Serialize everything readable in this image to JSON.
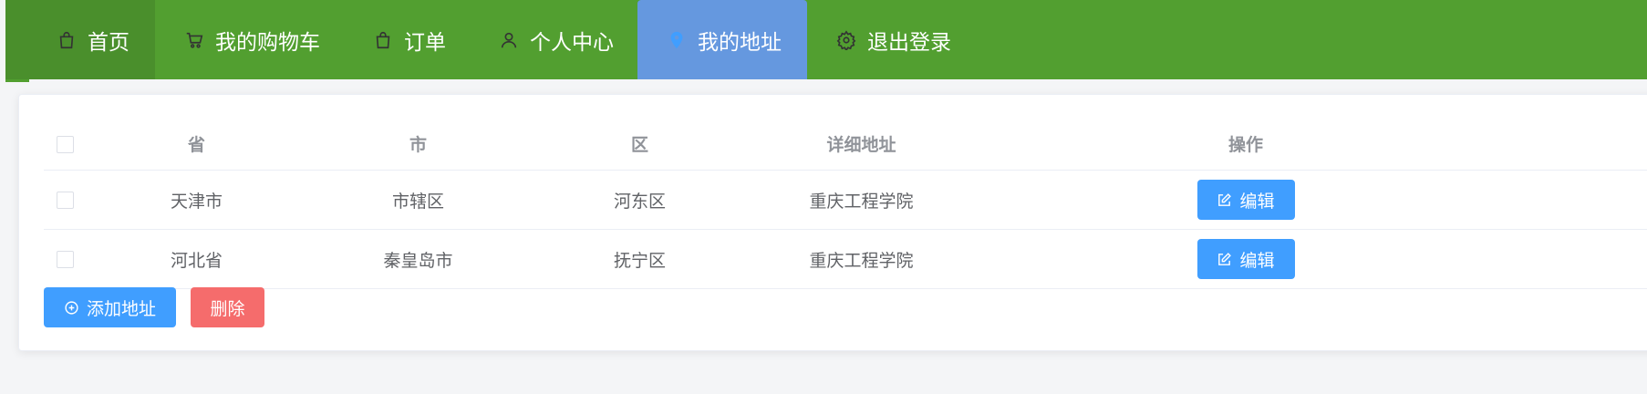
{
  "nav": {
    "items": [
      {
        "label": "首页",
        "icon": "shopping-bag-icon"
      },
      {
        "label": "我的购物车",
        "icon": "cart-icon"
      },
      {
        "label": "订单",
        "icon": "shopping-bag-icon"
      },
      {
        "label": "个人中心",
        "icon": "user-icon"
      },
      {
        "label": "我的地址",
        "icon": "location-icon"
      },
      {
        "label": "退出登录",
        "icon": "gear-icon"
      }
    ],
    "active_index": 4,
    "colors": {
      "bar": "#529f30",
      "active": "#6598df"
    }
  },
  "table": {
    "headers": [
      "省",
      "市",
      "区",
      "详细地址",
      "操作"
    ],
    "rows": [
      {
        "province": "天津市",
        "city": "市辖区",
        "district": "河东区",
        "address": "重庆工程学院",
        "action": "编辑"
      },
      {
        "province": "河北省",
        "city": "秦皇岛市",
        "district": "抚宁区",
        "address": "重庆工程学院",
        "action": "编辑"
      }
    ]
  },
  "actions": {
    "add_label": "添加地址",
    "delete_label": "删除",
    "colors": {
      "primary": "#409eff",
      "danger": "#f56c6c"
    }
  }
}
